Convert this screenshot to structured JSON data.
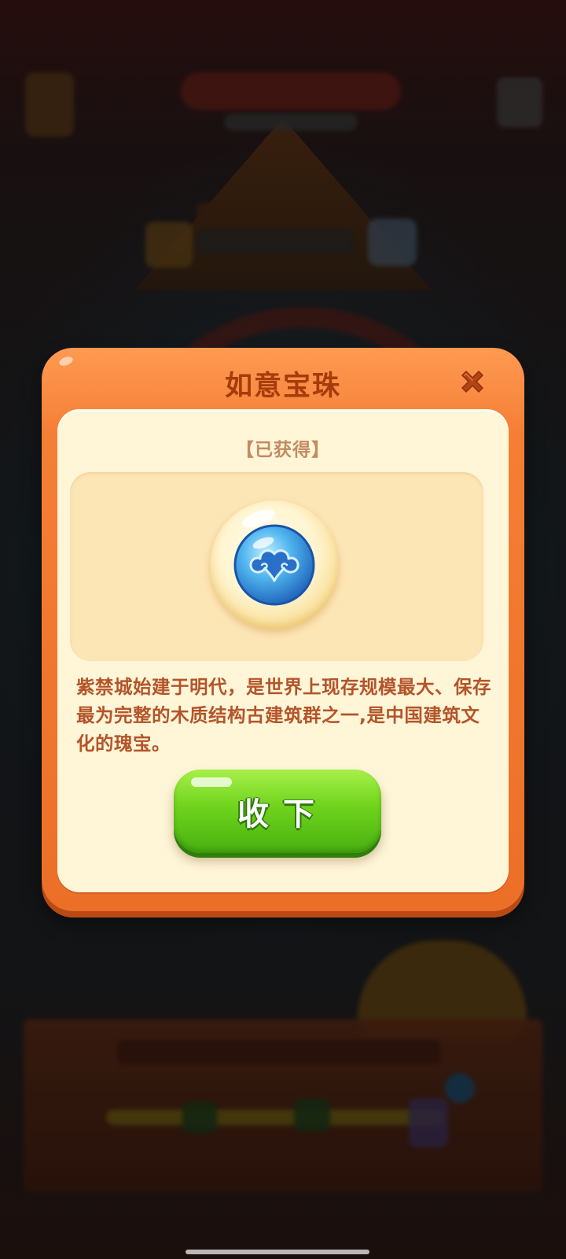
{
  "dialog": {
    "title": "如意宝珠",
    "status_left_bracket": "【",
    "status": "已获得",
    "status_right_bracket": "】",
    "item_icon": "cloud-pearl-icon",
    "description": "紫禁城始建于明代，是世界上现存规模最大、保存最为完整的木质结构古建筑群之一,是中国建筑文化的瑰宝。",
    "collect_label": "收下",
    "close_icon": "close-icon"
  },
  "colors": {
    "dialog_frame": "#f57e35",
    "card_bg": "#fff6d8",
    "title_text": "#a63b0c",
    "description_text": "#b4542a",
    "collect_button": "#6fd31c",
    "close_icon": "#b44415"
  }
}
